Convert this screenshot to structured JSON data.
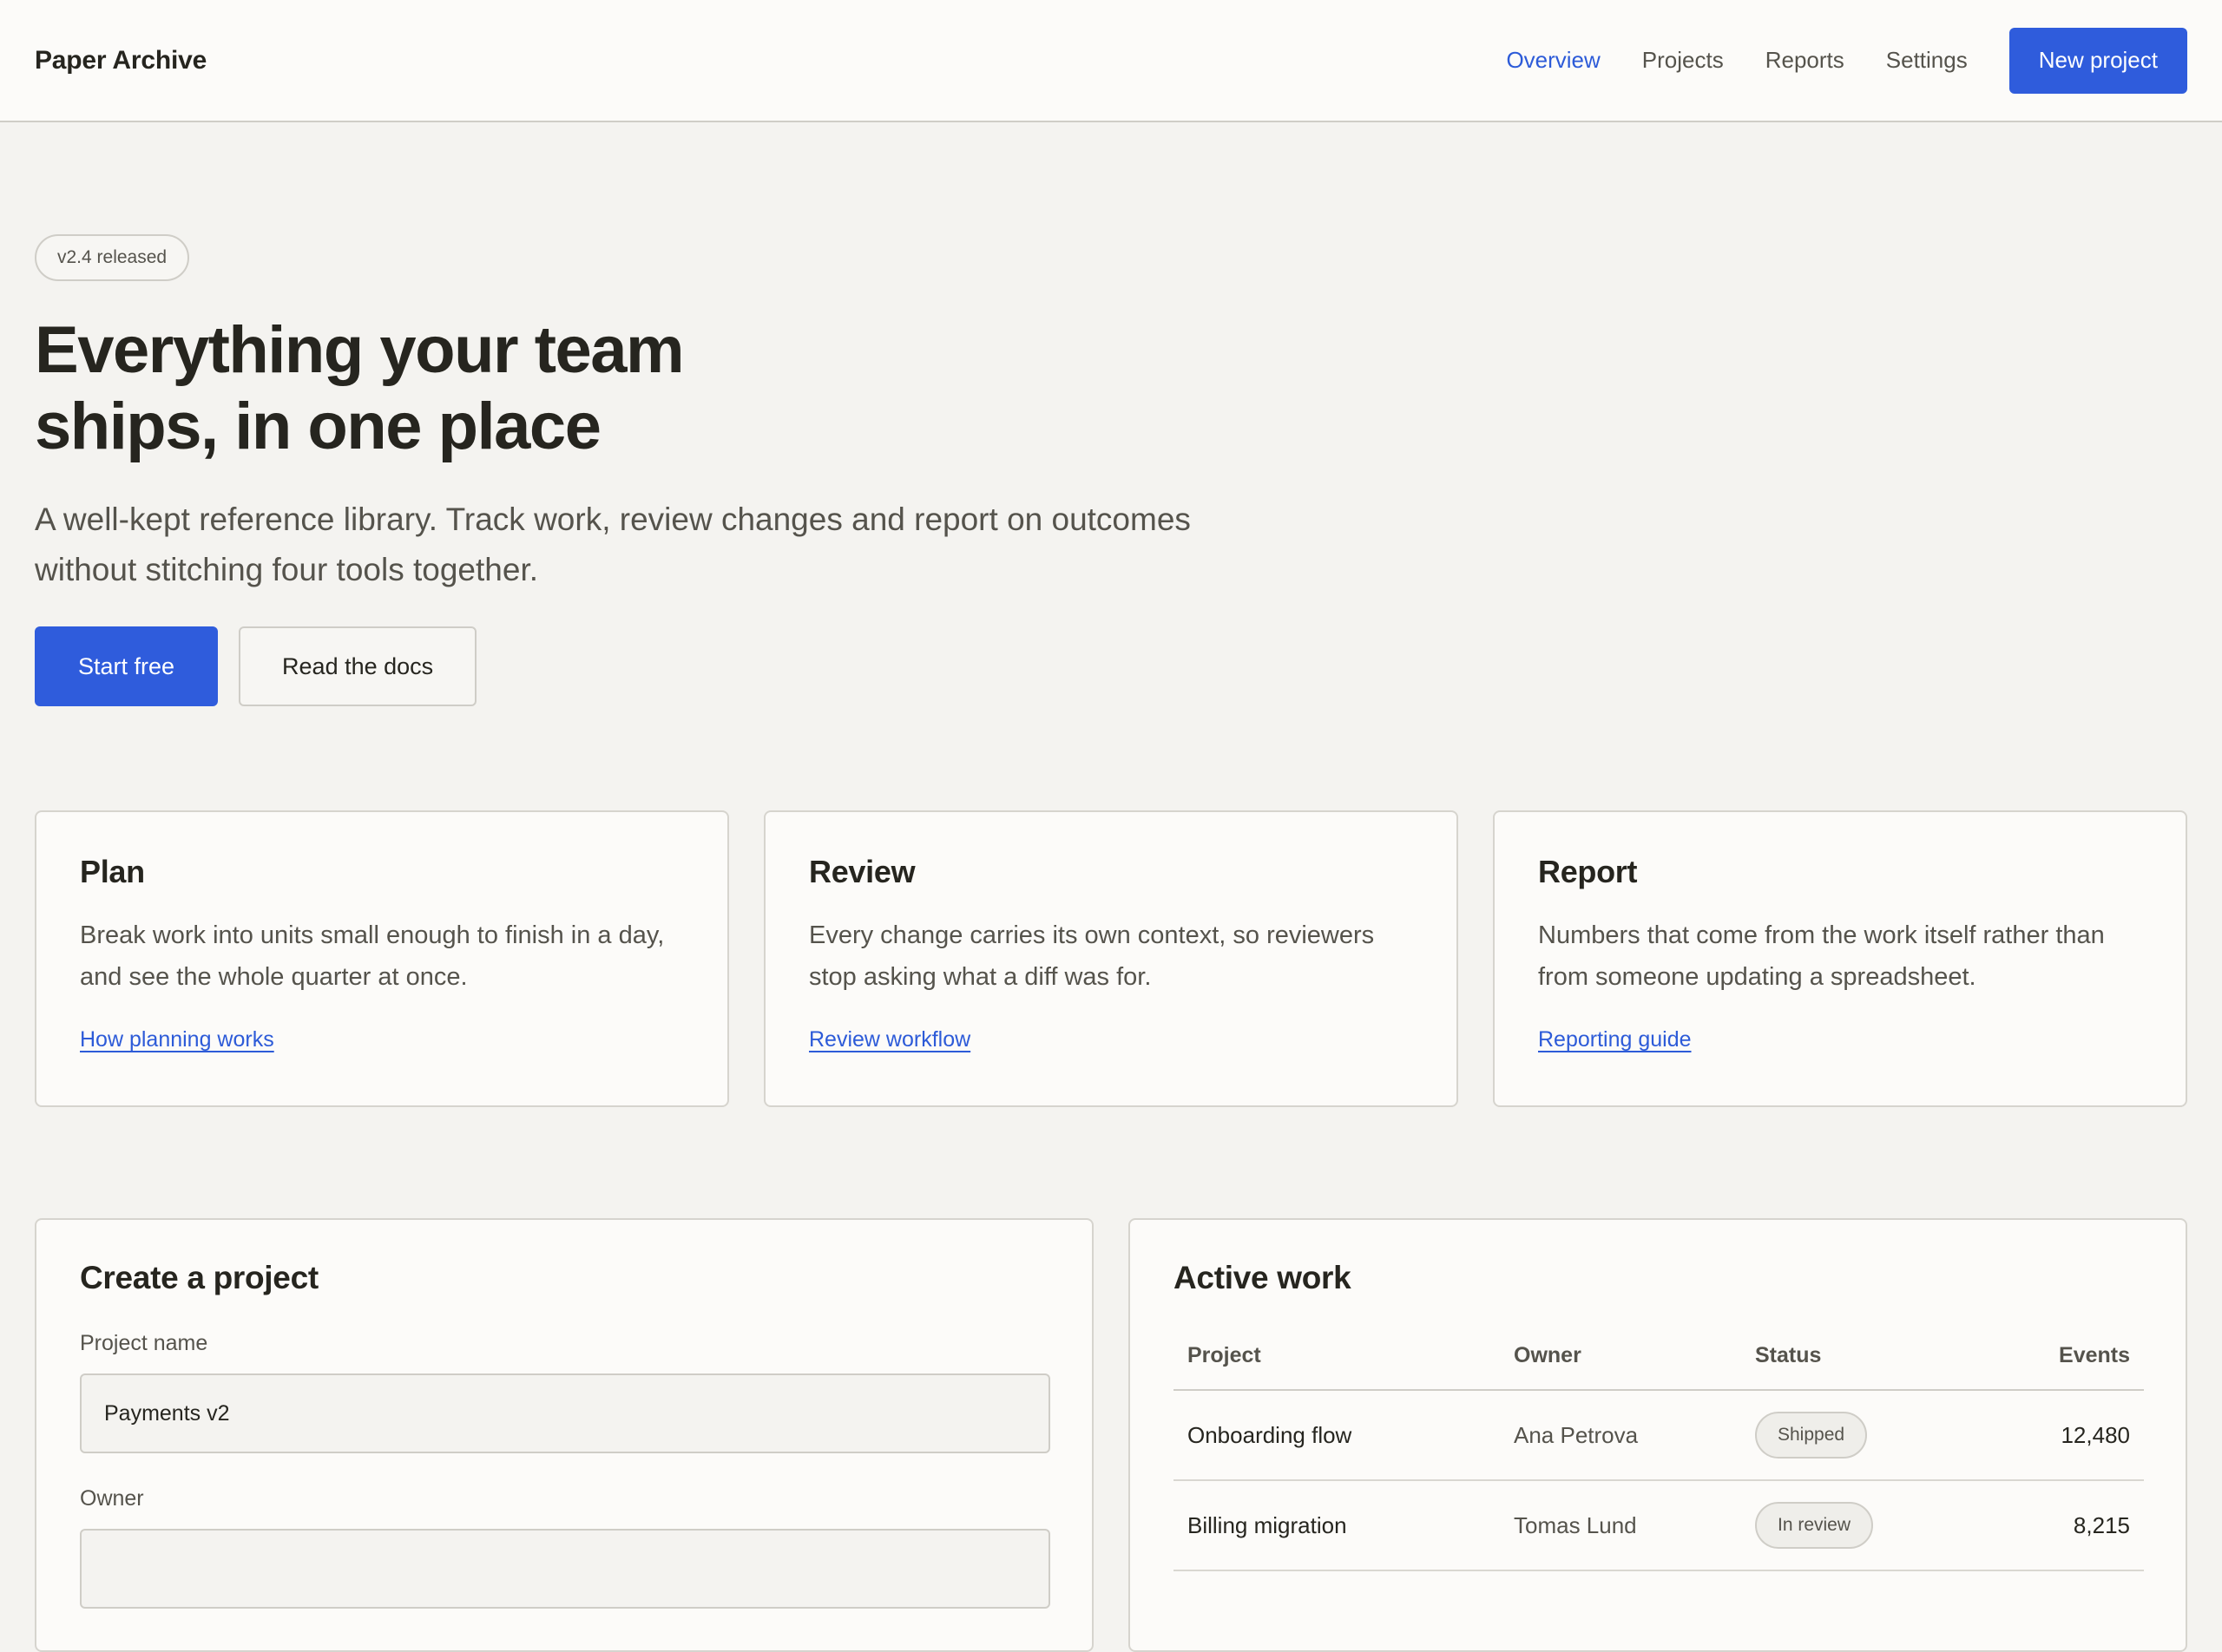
{
  "header": {
    "brand": "Paper Archive",
    "nav": [
      {
        "label": "Overview",
        "active": true
      },
      {
        "label": "Projects",
        "active": false
      },
      {
        "label": "Reports",
        "active": false
      },
      {
        "label": "Settings",
        "active": false
      }
    ],
    "cta_label": "New project"
  },
  "hero": {
    "badge": "v2.4 released",
    "headline": "Everything your team ships, in one place",
    "subline": "A well-kept reference library. Track work, review changes and report on outcomes without stitching four tools together.",
    "primary_label": "Start free",
    "secondary_label": "Read the docs"
  },
  "features": [
    {
      "title": "Plan",
      "desc": "Break work into units small enough to finish in a day, and see the whole quarter at once.",
      "link": "How planning works"
    },
    {
      "title": "Review",
      "desc": "Every change carries its own context, so reviewers stop asking what a diff was for.",
      "link": "Review workflow"
    },
    {
      "title": "Report",
      "desc": "Numbers that come from the work itself rather than from someone updating a spreadsheet.",
      "link": "Reporting guide"
    }
  ],
  "create_project": {
    "title": "Create a project",
    "name_label": "Project name",
    "name_value": "Payments v2",
    "owner_label": "Owner"
  },
  "active_work": {
    "title": "Active work",
    "columns": [
      "Project",
      "Owner",
      "Status",
      "Events"
    ],
    "rows": [
      {
        "project": "Onboarding flow",
        "owner": "Ana Petrova",
        "status": "Shipped",
        "events": "12,480"
      },
      {
        "project": "Billing migration",
        "owner": "Tomas Lund",
        "status": "In review",
        "events": "8,215"
      }
    ]
  },
  "colors": {
    "accent": "#2f5cdc",
    "background": "#f4f3f0",
    "surface": "#fcfbf9",
    "text": "#26251f",
    "muted_text": "#55534c"
  }
}
